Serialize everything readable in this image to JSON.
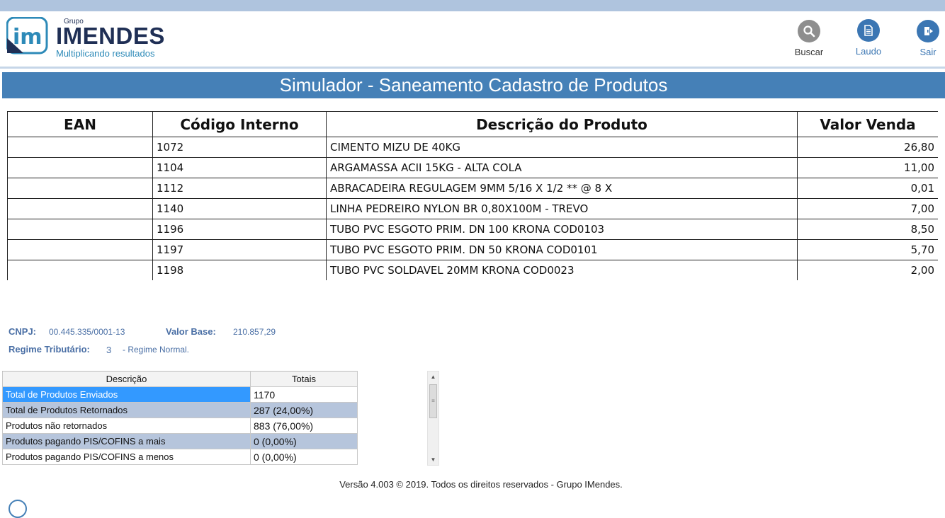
{
  "brand": {
    "group": "Grupo",
    "name": "IMENDES",
    "tagline": "Multiplicando resultados"
  },
  "toolbar": {
    "buscar": {
      "label": "Buscar",
      "icon": "search-icon"
    },
    "laudo": {
      "label": "Laudo",
      "icon": "document-icon"
    },
    "sair": {
      "label": "Sair",
      "icon": "exit-door-icon"
    }
  },
  "page": {
    "title": "Simulador - Saneamento Cadastro de Produtos"
  },
  "products": {
    "headers": [
      "EAN",
      "Código Interno",
      "Descrição do Produto",
      "Valor Venda"
    ],
    "rows": [
      {
        "ean": "",
        "codigo": "1072",
        "descricao": "CIMENTO MIZU DE 40KG",
        "valor": "26,80"
      },
      {
        "ean": "",
        "codigo": "1104",
        "descricao": "ARGAMASSA ACII 15KG - ALTA COLA",
        "valor": "11,00"
      },
      {
        "ean": "",
        "codigo": "1112",
        "descricao": "ABRACADEIRA REGULAGEM 9MM 5/16 X 1/2 ** @ 8 X",
        "valor": "0,01"
      },
      {
        "ean": "",
        "codigo": "1140",
        "descricao": "LINHA PEDREIRO NYLON BR 0,80X100M - TREVO",
        "valor": "7,00"
      },
      {
        "ean": "",
        "codigo": "1196",
        "descricao": "TUBO PVC ESGOTO PRIM. DN 100 KRONA COD0103",
        "valor": "8,50"
      },
      {
        "ean": "",
        "codigo": "1197",
        "descricao": "TUBO PVC ESGOTO PRIM. DN 50 KRONA COD0101",
        "valor": "5,70"
      },
      {
        "ean": "",
        "codigo": "1198",
        "descricao": "TUBO PVC SOLDAVEL 20MM KRONA COD0023",
        "valor": "2,00"
      }
    ]
  },
  "info": {
    "cnpj_label": "CNPJ:",
    "cnpj_value": "00.445.335/0001-13",
    "valor_base_label": "Valor Base:",
    "valor_base_value": "210.857,29",
    "regime_label": "Regime Tributário:",
    "regime_code": "3",
    "regime_desc": "- Regime Normal."
  },
  "totals": {
    "headers": [
      "Descrição",
      "Totais"
    ],
    "rows": [
      {
        "descricao": "Total de Produtos Enviados",
        "total": "1170"
      },
      {
        "descricao": "Total de Produtos Retornados",
        "total": "287 (24,00%)"
      },
      {
        "descricao": "Produtos não retornados",
        "total": "883 (76,00%)"
      },
      {
        "descricao": "Produtos pagando PIS/COFINS a mais",
        "total": "0  (0,00%)"
      },
      {
        "descricao": "Produtos pagando PIS/COFINS a menos",
        "total": "0  (0,00%)"
      }
    ]
  },
  "footer": {
    "text": "Versão 4.003 © 2019. Todos os direitos reservados - Grupo IMendes."
  },
  "colors": {
    "accent": "#4580b7",
    "selection": "#3399ff",
    "alt_row": "#b6c5dc",
    "top_band": "#afc4de"
  }
}
